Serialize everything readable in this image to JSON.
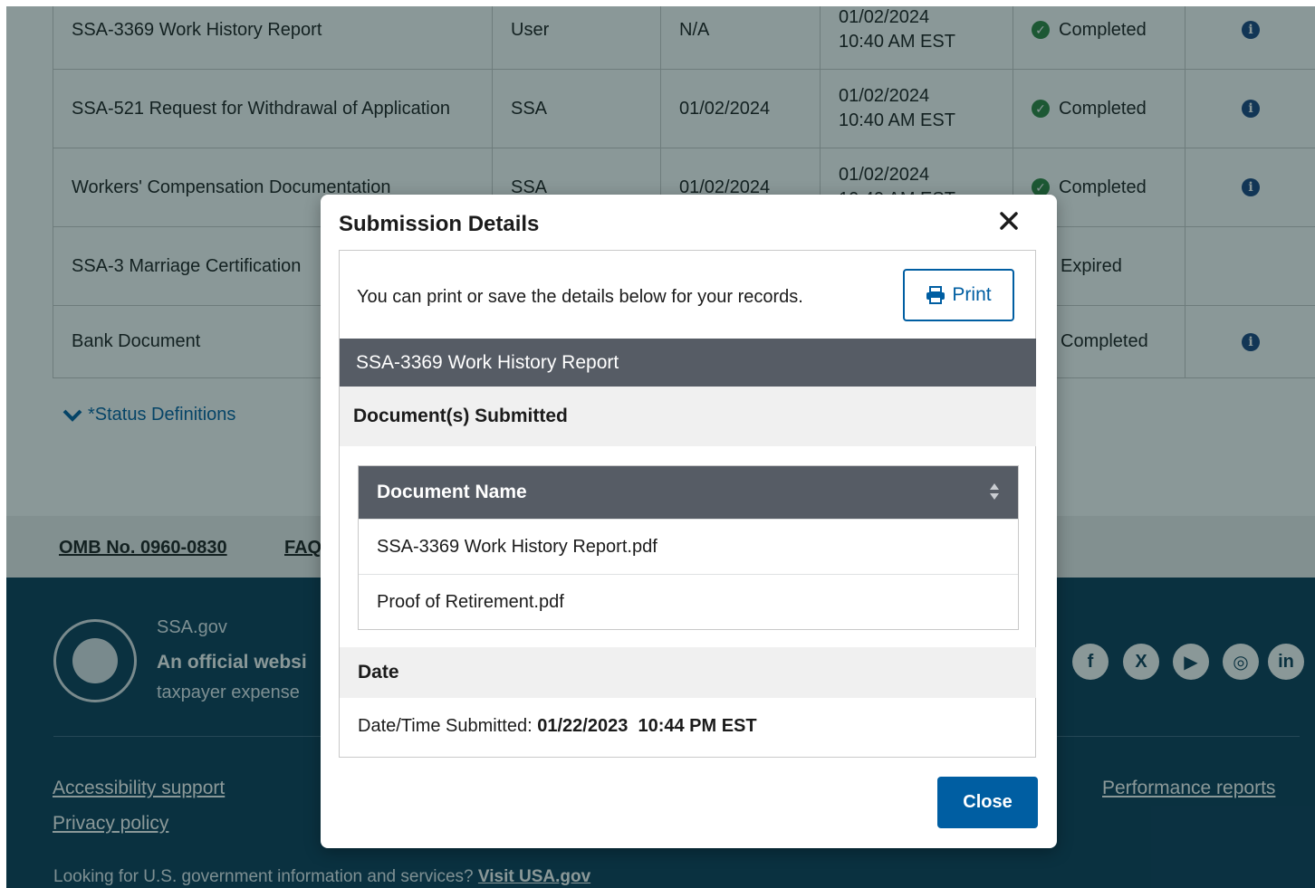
{
  "table": {
    "rows": [
      {
        "name": "SSA-3369 Work History Report",
        "source": "User",
        "due": "N/A",
        "date": "01/02/2024",
        "time": "10:40 AM EST",
        "status": "Completed",
        "has_info": true,
        "has_check": true
      },
      {
        "name": "SSA-521 Request for Withdrawal of Application",
        "source": "SSA",
        "due": "01/02/2024",
        "date": "01/02/2024",
        "time": "10:40 AM EST",
        "status": "Completed",
        "has_info": true,
        "has_check": true
      },
      {
        "name": "Workers' Compensation Documentation",
        "source": "SSA",
        "due": "01/02/2024",
        "date": "01/02/2024",
        "time": "10:40 AM EST",
        "status": "Completed",
        "has_info": true,
        "has_check": true
      },
      {
        "name": "SSA-3 Marriage Certification",
        "source": "",
        "due": "",
        "date": "",
        "time": "",
        "status": "Expired",
        "has_info": false,
        "has_check": false
      },
      {
        "name": "Bank Document",
        "source": "",
        "due": "",
        "date": "",
        "time": "",
        "status": "Completed",
        "has_info": true,
        "has_check": false
      }
    ],
    "status_definitions": "*Status Definitions"
  },
  "footer_strip": {
    "omb": "OMB No. 0960-0830",
    "faq": "FAQ"
  },
  "footer": {
    "site": "SSA.gov",
    "official": "An official websi",
    "taxpayer": "taxpayer expense",
    "social": [
      "facebook-icon",
      "x-icon",
      "youtube-icon",
      "instagram-icon",
      "linkedin-icon"
    ],
    "links": {
      "accessibility": "Accessibility support",
      "privacy": "Privacy policy",
      "performance": "Performance reports"
    },
    "looking": "Looking for U.S. government information and services?",
    "visit": "Visit USA.gov"
  },
  "modal": {
    "title": "Submission Details",
    "intro": "You can print or save the details below for your records.",
    "print_label": "Print",
    "section_title": "SSA-3369 Work History Report",
    "docs_heading": "Document(s) Submitted",
    "column_header": "Document Name",
    "documents": [
      "SSA-3369 Work History Report.pdf",
      "Proof of Retirement.pdf"
    ],
    "date_heading": "Date",
    "date_label": "Date/Time Submitted:",
    "date_value": "01/22/2023  10:44 PM EST",
    "close_label": "Close"
  },
  "colors": {
    "primary": "#005ea2",
    "section_header": "#565c65",
    "footer_bg": "#0b3a57",
    "success": "#2e8540"
  }
}
